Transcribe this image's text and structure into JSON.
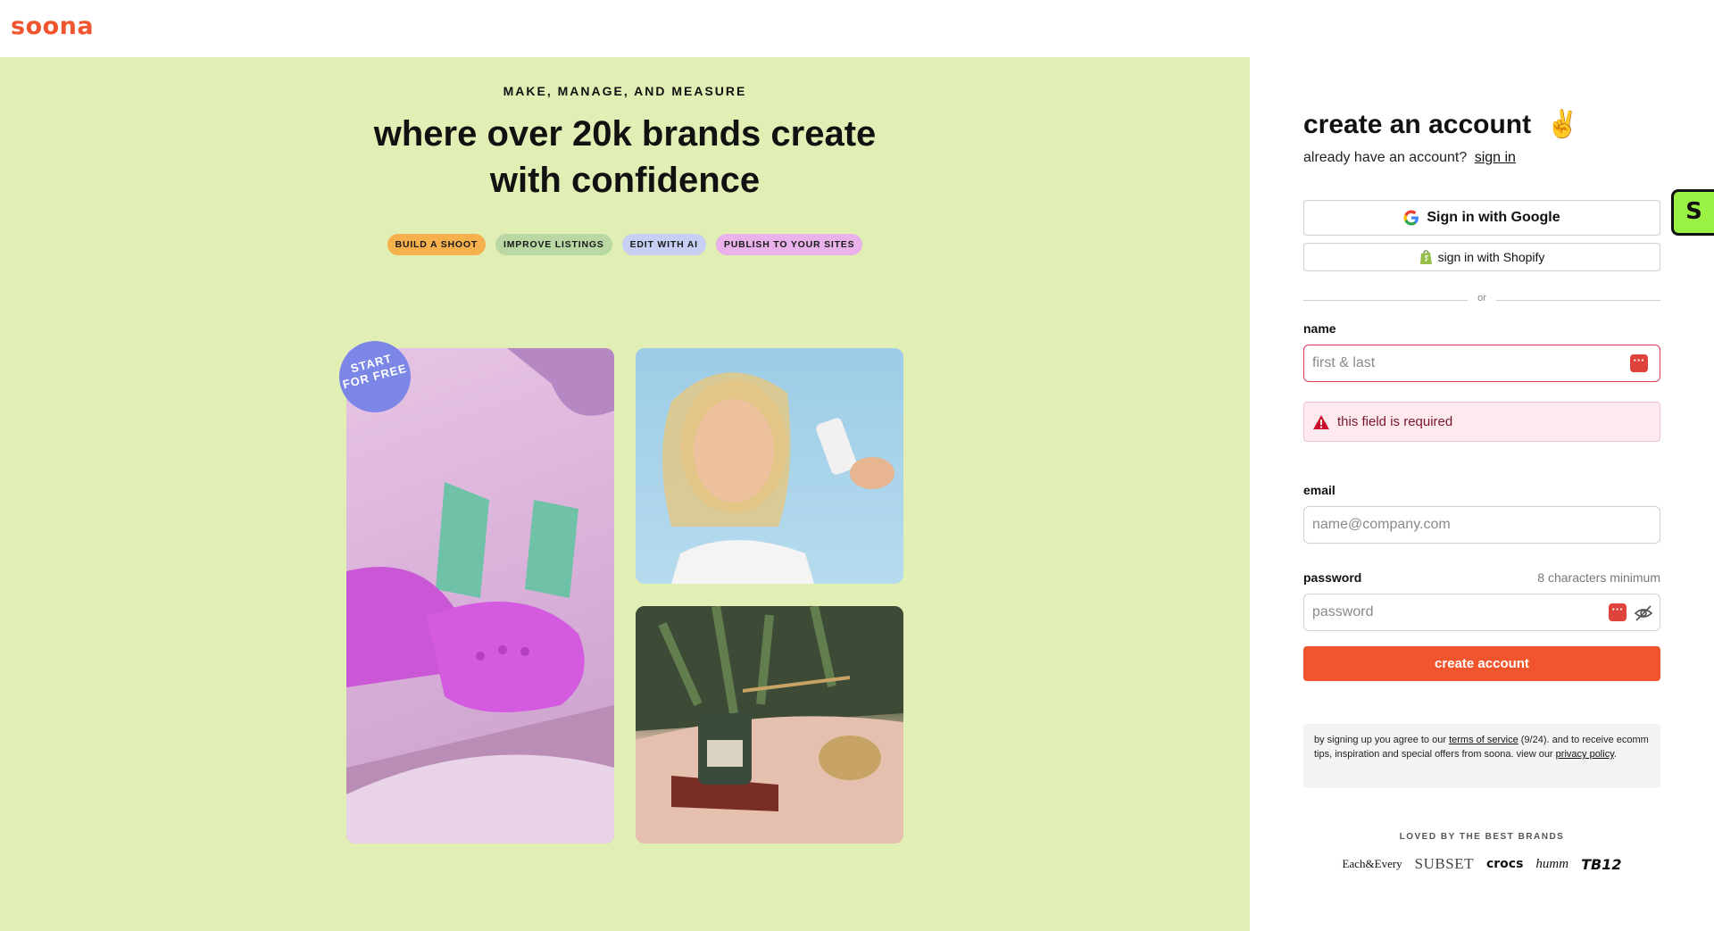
{
  "header": {
    "logo": "soona"
  },
  "hero": {
    "eyebrow": "MAKE, MANAGE, AND MEASURE",
    "headline": "where over 20k brands create with confidence",
    "pills": [
      "BUILD A SHOOT",
      "IMPROVE LISTINGS",
      "EDIT WITH AI",
      "PUBLISH TO YOUR SITES"
    ],
    "badge": "START FOR FREE"
  },
  "form": {
    "title": "create an account",
    "title_emoji": "✌",
    "already_text": "already have an account?",
    "signin_link": "sign in",
    "google_button": "Sign in with Google",
    "shopify_button": "sign in with Shopify",
    "divider_text": "or",
    "name_label": "name",
    "name_placeholder": "first & last",
    "name_error": "this field is required",
    "email_label": "email",
    "email_placeholder": "name@company.com",
    "password_label": "password",
    "password_hint": "8 characters minimum",
    "password_placeholder": "password",
    "submit_label": "create account"
  },
  "terms": {
    "prefix": "by signing up you agree to our",
    "tos_link": "terms of service",
    "middle": "(9/24). and to receive ecomm tips, inspiration and special offers from soona. view our",
    "privacy_link": "privacy policy",
    "suffix": "."
  },
  "brands": {
    "heading": "LOVED BY THE BEST BRANDS",
    "items": [
      "Each&Every",
      "SUBSET",
      "crocs",
      "humm",
      "TB12"
    ]
  },
  "side_tab": {
    "letter": "S"
  },
  "colors": {
    "accent": "#f0552d",
    "hero_bg": "#e2efb4",
    "error": "#d93a5a"
  }
}
